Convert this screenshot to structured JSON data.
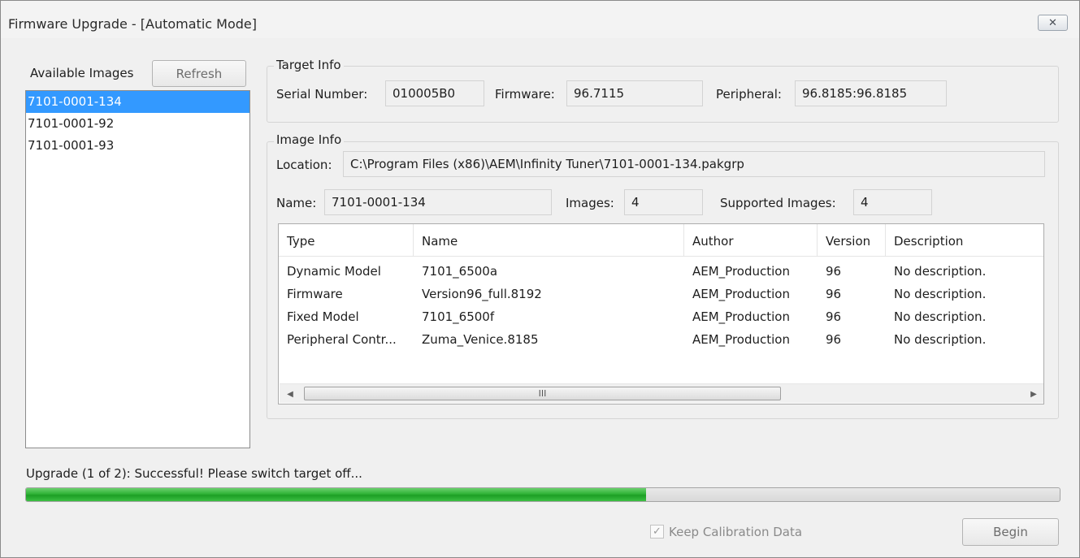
{
  "window": {
    "title": "Firmware Upgrade - [Automatic Mode]",
    "close_glyph": "✕"
  },
  "images_panel": {
    "label": "Available Images",
    "refresh_label": "Refresh",
    "items": [
      {
        "label": "7101-0001-134",
        "selected": true
      },
      {
        "label": "7101-0001-92",
        "selected": false
      },
      {
        "label": "7101-0001-93",
        "selected": false
      }
    ]
  },
  "target_info": {
    "title": "Target Info",
    "serial_label": "Serial Number:",
    "serial_value": "010005B0",
    "firmware_label": "Firmware:",
    "firmware_value": "96.7115",
    "peripheral_label": "Peripheral:",
    "peripheral_value": "96.8185:96.8185"
  },
  "image_info": {
    "title": "Image Info",
    "location_label": "Location:",
    "location_value": "C:\\Program Files (x86)\\AEM\\Infinity Tuner\\7101-0001-134.pakgrp",
    "name_label": "Name:",
    "name_value": "7101-0001-134",
    "images_label": "Images:",
    "images_value": "4",
    "supported_label": "Supported Images:",
    "supported_value": "4"
  },
  "table": {
    "columns": [
      "Type",
      "Name",
      "Author",
      "Version",
      "Description"
    ],
    "rows": [
      [
        "Dynamic Model",
        "7101_6500a",
        "AEM_Production",
        "96",
        "No description."
      ],
      [
        "Firmware",
        "Version96_full.8192",
        "AEM_Production",
        "96",
        "No description."
      ],
      [
        "Fixed Model",
        "7101_6500f",
        "AEM_Production",
        "96",
        "No description."
      ],
      [
        "Peripheral Contr...",
        "Zuma_Venice.8185",
        "AEM_Production",
        "96",
        "No description."
      ]
    ],
    "scroll_left": "◀",
    "scroll_right": "▶",
    "scroll_grip": "III"
  },
  "status": {
    "message": "Upgrade (1 of 2): Successful!  Please switch target off...",
    "progress_fraction": 0.6
  },
  "footer": {
    "keep_calibration_label": "Keep Calibration Data",
    "keep_calibration_checked": true,
    "check_glyph": "✓",
    "begin_label": "Begin"
  },
  "colors": {
    "selection": "#3399ff",
    "progress": "#2fb236"
  }
}
